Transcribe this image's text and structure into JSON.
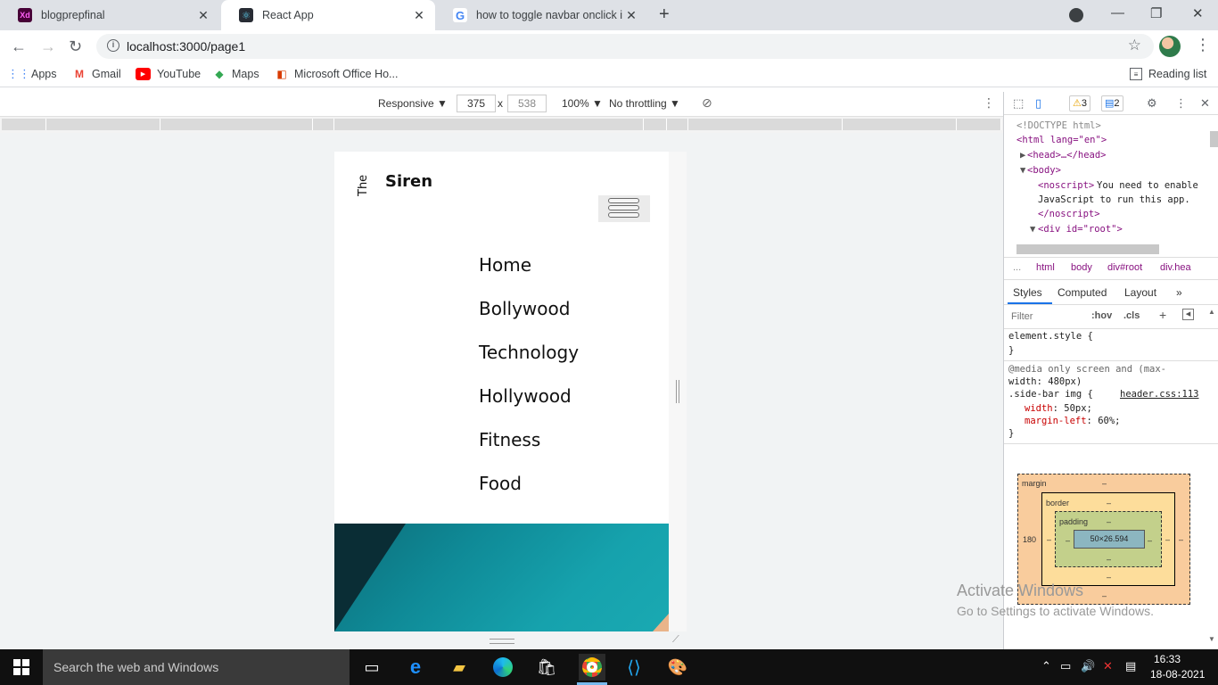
{
  "browser": {
    "tabs": [
      {
        "title": "blogprepfinal",
        "favicon": "Xd",
        "favicon_color": "#470137"
      },
      {
        "title": "React App",
        "favicon": "react-icon",
        "favicon_color": "#282c34"
      },
      {
        "title": "how to toggle navbar onclick in r",
        "favicon": "google-icon",
        "favicon_color": "#4285f4"
      }
    ],
    "new_tab": "+",
    "url": "localhost:3000/page1",
    "bookmarks": [
      "Apps",
      "Gmail",
      "YouTube",
      "Maps",
      "Microsoft Office Ho..."
    ],
    "reading_list": "Reading list"
  },
  "device_toolbar": {
    "mode": "Responsive",
    "width": "375",
    "times": "x",
    "height": "538",
    "zoom": "100%",
    "throttling": "No throttling"
  },
  "page": {
    "brand_prefix": "The",
    "brand": "Siren",
    "menu": [
      "Home",
      "Bollywood",
      "Technology",
      "Hollywood",
      "Fitness",
      "Food"
    ]
  },
  "devtools": {
    "warnings": "3",
    "messages": "2",
    "dom": {
      "doctype": "<!DOCTYPE html>",
      "html_open": "<html lang=\"en\">",
      "head": "<head>…</head>",
      "body": "<body>",
      "noscript_open": "<noscript>",
      "noscript_text_1": "You need to enable",
      "noscript_text_2": "JavaScript to run this app.",
      "noscript_close": "</noscript>",
      "div_root": "<div id=\"root\">"
    },
    "breadcrumbs": [
      "...",
      "html",
      "body",
      "div#root",
      "div.hea"
    ],
    "tabs": [
      "Styles",
      "Computed",
      "Layout"
    ],
    "filter_placeholder": "Filter",
    "hov": ":hov",
    "cls": ".cls",
    "styles": {
      "element_style": "element.style {",
      "close": "}",
      "media_1": "@media only screen and (max-",
      "media_2": "width: 480px)",
      "selector": ".side-bar img {",
      "source": "header.css:113",
      "prop1_name": "width",
      "prop1_val": "50px;",
      "prop2_name": "margin-left",
      "prop2_val": "60%;"
    },
    "box_model": {
      "margin_label": "margin",
      "border_label": "border",
      "padding_label": "padding",
      "content": "50×26.594",
      "margin_left": "180",
      "dash": "–"
    }
  },
  "watermark": {
    "line1": "Activate Windows",
    "line2": "Go to Settings to activate Windows."
  },
  "taskbar": {
    "search_placeholder": "Search the web and Windows",
    "time": "16:33",
    "date": "18-08-2021"
  }
}
